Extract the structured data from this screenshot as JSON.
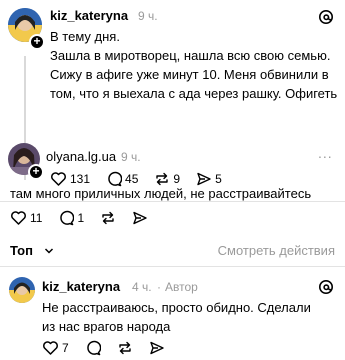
{
  "colors": {
    "text": "#000000",
    "muted": "#9a9a9a",
    "divider": "#e3e3e3",
    "thread_line": "#d9d9d9"
  },
  "posts": [
    {
      "author": "kiz_kateryna",
      "time": "9 ч.",
      "text": "В тему дня.\nЗашла в миротворец, нашла всю свою семью.\nСижу в афиге уже минут 10. Меня обвинили в том, что я выехала с ада через рашку. Офигеть",
      "likes": "131",
      "comments": "45",
      "reposts": "9",
      "shares": "5"
    },
    {
      "author": "olyana.lg.ua",
      "time": "9 ч.",
      "more": "...",
      "text": "там много приличных людей, не расстраивайтесь",
      "likes": "11",
      "comments": "1"
    }
  ],
  "section": {
    "title": "Топ",
    "chevron": "v",
    "actions_link": "Смотреть действия"
  },
  "reply": {
    "author": "kiz_kateryna",
    "time": "4 ч.",
    "author_tag": "Автор",
    "text": "Не расстраиваюсь, просто обидно. Сделали из нас врагов народа",
    "likes": "7"
  },
  "icons": [
    "threads-logo-icon",
    "heart-icon",
    "comment-icon",
    "repost-icon",
    "share-icon",
    "plus-icon",
    "chevron-down-icon"
  ]
}
